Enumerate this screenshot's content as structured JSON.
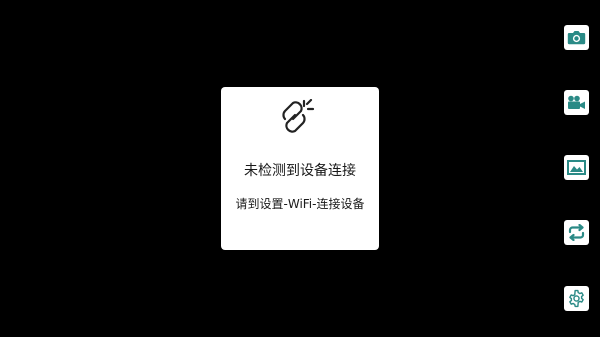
{
  "dialog": {
    "icon": "broken-link-icon",
    "title": "未检测到设备连接",
    "hint": "请到设置-WiFi-连接设备"
  },
  "sidebar": {
    "buttons": [
      {
        "name": "camera-button",
        "icon": "camera-icon"
      },
      {
        "name": "video-button",
        "icon": "video-camera-icon"
      },
      {
        "name": "gallery-button",
        "icon": "image-icon"
      },
      {
        "name": "switch-camera-button",
        "icon": "refresh-icon"
      },
      {
        "name": "settings-button",
        "icon": "gear-icon"
      }
    ],
    "icon_color": "#2a8a86"
  }
}
